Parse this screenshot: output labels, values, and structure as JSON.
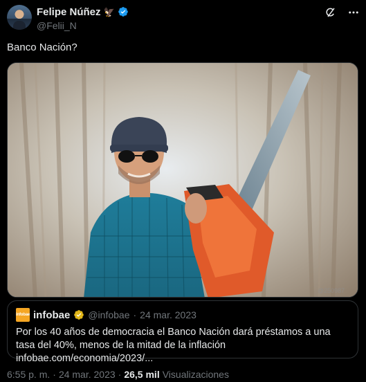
{
  "author": {
    "display_name": "Felipe Núñez",
    "handle": "@Felii_N",
    "name_emoji": "🦅"
  },
  "tweet": {
    "text": "Banco Nación?"
  },
  "quoted": {
    "source_name": "infobae",
    "source_logo_text": "infobae",
    "handle": "@infobae",
    "separator": "·",
    "date": "24 mar. 2023",
    "text": "Por los 40 años de democracia el Banco Nación dará préstamos a una tasa del 40%, menos de la mitad de la inflación infobae.com/economia/2023/..."
  },
  "footer": {
    "time": "6:55 p. m.",
    "dot1": "·",
    "date": "24 mar. 2023",
    "dot2": "·",
    "views_count": "26,5 mil",
    "views_label": "Visualizaciones"
  },
  "colors": {
    "background": "#000000",
    "text_primary": "#e7e9ea",
    "text_secondary": "#71767b",
    "verified_blue": "#1d9bf0",
    "verified_gold": "#e2b719",
    "border": "#2f3336"
  }
}
